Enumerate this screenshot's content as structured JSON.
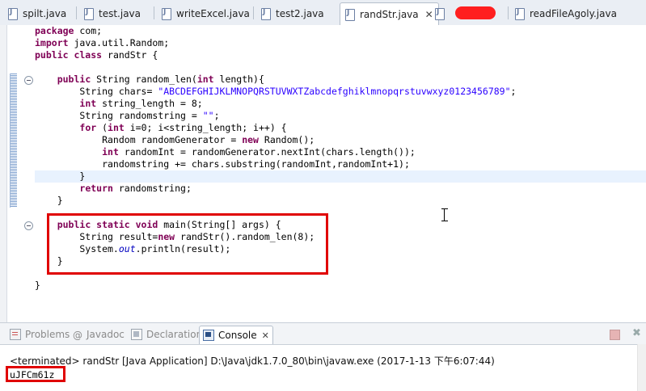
{
  "tabs": [
    {
      "label": "spilt.java",
      "active": false
    },
    {
      "label": "test.java",
      "active": false
    },
    {
      "label": "writeExcel.java",
      "active": false
    },
    {
      "label": "test2.java",
      "active": false
    },
    {
      "label": "randStr.java",
      "active": true
    },
    {
      "label": "readFileAgoly.java",
      "active": false
    }
  ],
  "close_glyph": "✕",
  "editor": {
    "lines": [
      [
        {
          "t": "package",
          "c": "kw"
        },
        {
          "t": " com;"
        }
      ],
      [
        {
          "t": "import",
          "c": "kw"
        },
        {
          "t": " java.util.Random;"
        }
      ],
      [
        {
          "t": "public class",
          "c": "kw"
        },
        {
          "t": " randStr {"
        }
      ],
      [
        {
          "t": ""
        }
      ],
      [
        {
          "t": "    "
        },
        {
          "t": "public",
          "c": "kw"
        },
        {
          "t": " String random_len("
        },
        {
          "t": "int",
          "c": "kw"
        },
        {
          "t": " length){"
        }
      ],
      [
        {
          "t": "        String chars= "
        },
        {
          "t": "\"ABCDEFGHIJKLMNOPQRSTUVWXTZabcdefghiklmnopqrstuvwxyz0123456789\"",
          "c": "st"
        },
        {
          "t": ";"
        }
      ],
      [
        {
          "t": "        "
        },
        {
          "t": "int",
          "c": "kw"
        },
        {
          "t": " string_length = 8;"
        }
      ],
      [
        {
          "t": "        String randomstring = "
        },
        {
          "t": "\"\"",
          "c": "st"
        },
        {
          "t": ";"
        }
      ],
      [
        {
          "t": "        "
        },
        {
          "t": "for",
          "c": "kw"
        },
        {
          "t": " ("
        },
        {
          "t": "int",
          "c": "kw"
        },
        {
          "t": " i=0; i<string_length; i++) {"
        }
      ],
      [
        {
          "t": "            Random randomGenerator = "
        },
        {
          "t": "new",
          "c": "kw"
        },
        {
          "t": " Random();"
        }
      ],
      [
        {
          "t": "            "
        },
        {
          "t": "int",
          "c": "kw"
        },
        {
          "t": " randomInt = randomGenerator.nextInt(chars.length());"
        }
      ],
      [
        {
          "t": "            randomstring += chars.substring(randomInt,randomInt+1);"
        }
      ],
      [
        {
          "t": "        }"
        }
      ],
      [
        {
          "t": "        "
        },
        {
          "t": "return",
          "c": "kw"
        },
        {
          "t": " randomstring;"
        }
      ],
      [
        {
          "t": "    }"
        }
      ],
      [
        {
          "t": ""
        }
      ],
      [
        {
          "t": "    "
        },
        {
          "t": "public static void",
          "c": "kw"
        },
        {
          "t": " main(String[] args) {"
        }
      ],
      [
        {
          "t": "        String result="
        },
        {
          "t": "new",
          "c": "kw"
        },
        {
          "t": " randStr().random_len(8);"
        }
      ],
      [
        {
          "t": "        System."
        },
        {
          "t": "out",
          "c": "it"
        },
        {
          "t": ".println(result);"
        }
      ],
      [
        {
          "t": "    }"
        }
      ],
      [
        {
          "t": ""
        }
      ],
      [
        {
          "t": "}"
        }
      ]
    ],
    "highlighted_line": 12
  },
  "views": {
    "tabs": [
      {
        "label": "Problems",
        "icon": "problems-icon",
        "active": false
      },
      {
        "label": "Javadoc",
        "icon": "at-icon",
        "icon_glyph": "@",
        "active": false
      },
      {
        "label": "Declaration",
        "icon": "declaration-icon",
        "active": false
      },
      {
        "label": "Console",
        "icon": "console-icon",
        "active": true
      }
    ]
  },
  "console": {
    "terminated_line": "<terminated> randStr [Java Application] D:\\Java\\jdk1.7.0_80\\bin\\javaw.exe (2017-1-13 下午6:07:44)",
    "output": "uJFCm61z"
  },
  "colors": {
    "keyword": "#7f0055",
    "string": "#2a00ff",
    "static_field": "#0000c0",
    "annotation_box": "#e00000",
    "current_line": "#e8f2fe"
  }
}
